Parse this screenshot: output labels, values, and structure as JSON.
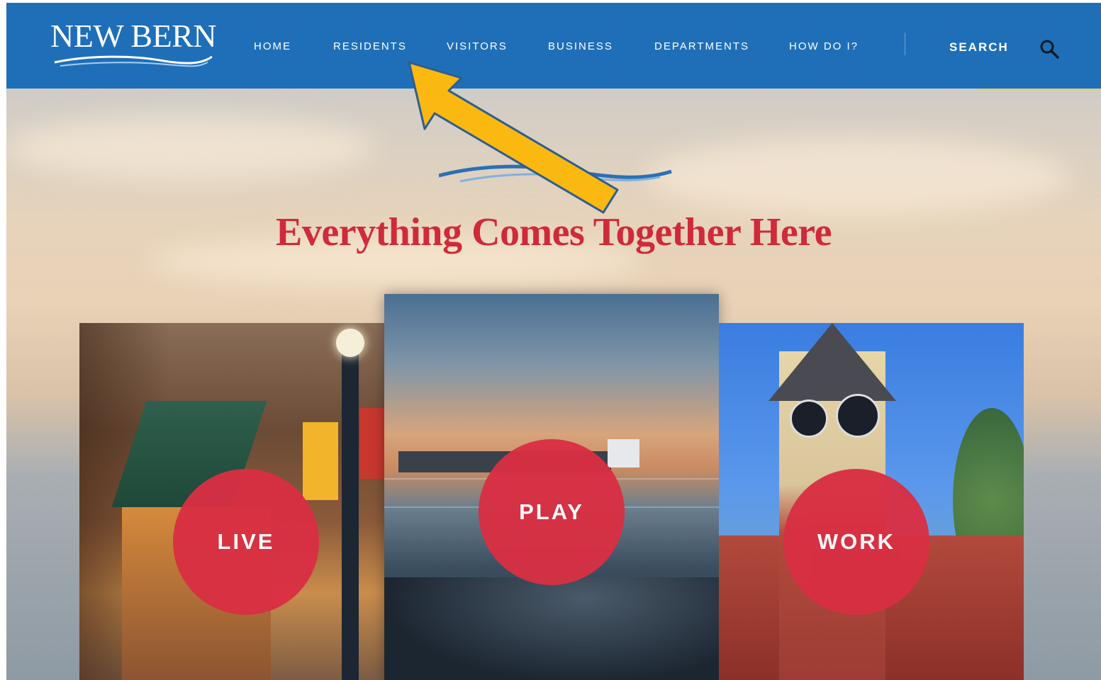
{
  "header": {
    "logo_text": "NEW BERN",
    "nav_items": [
      {
        "label": "HOME"
      },
      {
        "label": "RESIDENTS"
      },
      {
        "label": "VISITORS"
      },
      {
        "label": "BUSINESS"
      },
      {
        "label": "DEPARTMENTS"
      },
      {
        "label": "HOW DO I?"
      }
    ],
    "search_label": "SEARCH",
    "search_icon": "magnifier-icon"
  },
  "hero": {
    "headline": "Everything Comes Together Here"
  },
  "cards": [
    {
      "label": "LIVE"
    },
    {
      "label": "PLAY"
    },
    {
      "label": "WORK"
    }
  ],
  "annotation": {
    "arrow_color": "#fbb810",
    "points_to": "RESIDENTS"
  },
  "colors": {
    "nav_bar": "#1f6fb8",
    "headline": "#cf2a3a",
    "circle": "#d92f43"
  }
}
